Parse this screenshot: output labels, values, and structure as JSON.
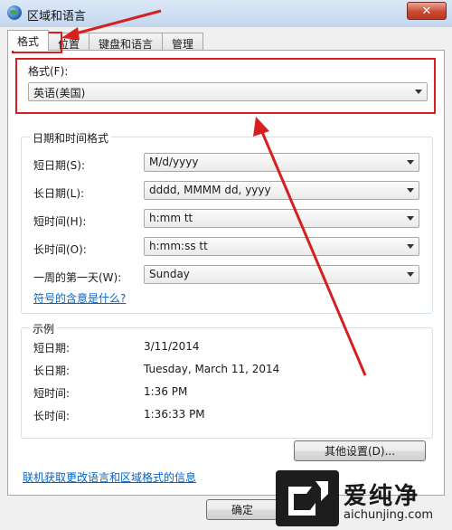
{
  "window": {
    "title": "区域和语言",
    "close_label": "✕"
  },
  "tabs": [
    {
      "label": "格式"
    },
    {
      "label": "位置"
    },
    {
      "label": "键盘和语言"
    },
    {
      "label": "管理"
    }
  ],
  "format": {
    "label": "格式(F):",
    "value": "英语(美国)"
  },
  "datetime": {
    "group_title": "日期和时间格式",
    "rows": [
      {
        "label": "短日期(S):",
        "value": "M/d/yyyy"
      },
      {
        "label": "长日期(L):",
        "value": "dddd, MMMM dd, yyyy"
      },
      {
        "label": "短时间(H):",
        "value": "h:mm tt"
      },
      {
        "label": "长时间(O):",
        "value": "h:mm:ss tt"
      },
      {
        "label": "一周的第一天(W):",
        "value": "Sunday"
      }
    ],
    "symbols_link": "符号的含意是什么?"
  },
  "example": {
    "group_title": "示例",
    "rows": [
      {
        "label": "短日期:",
        "value": "3/11/2014"
      },
      {
        "label": "长日期:",
        "value": "Tuesday, March 11, 2014"
      },
      {
        "label": "短时间:",
        "value": "1:36 PM"
      },
      {
        "label": "长时间:",
        "value": "1:36:33 PM"
      }
    ]
  },
  "other_settings_button": "其他设置(D)...",
  "online_info_link": "联机获取更改语言和区域格式的信息",
  "ok_button": "确定",
  "watermark": {
    "brand": "爱纯净",
    "url": "aichunjing.com"
  },
  "annotation_color": "#d61f1f"
}
